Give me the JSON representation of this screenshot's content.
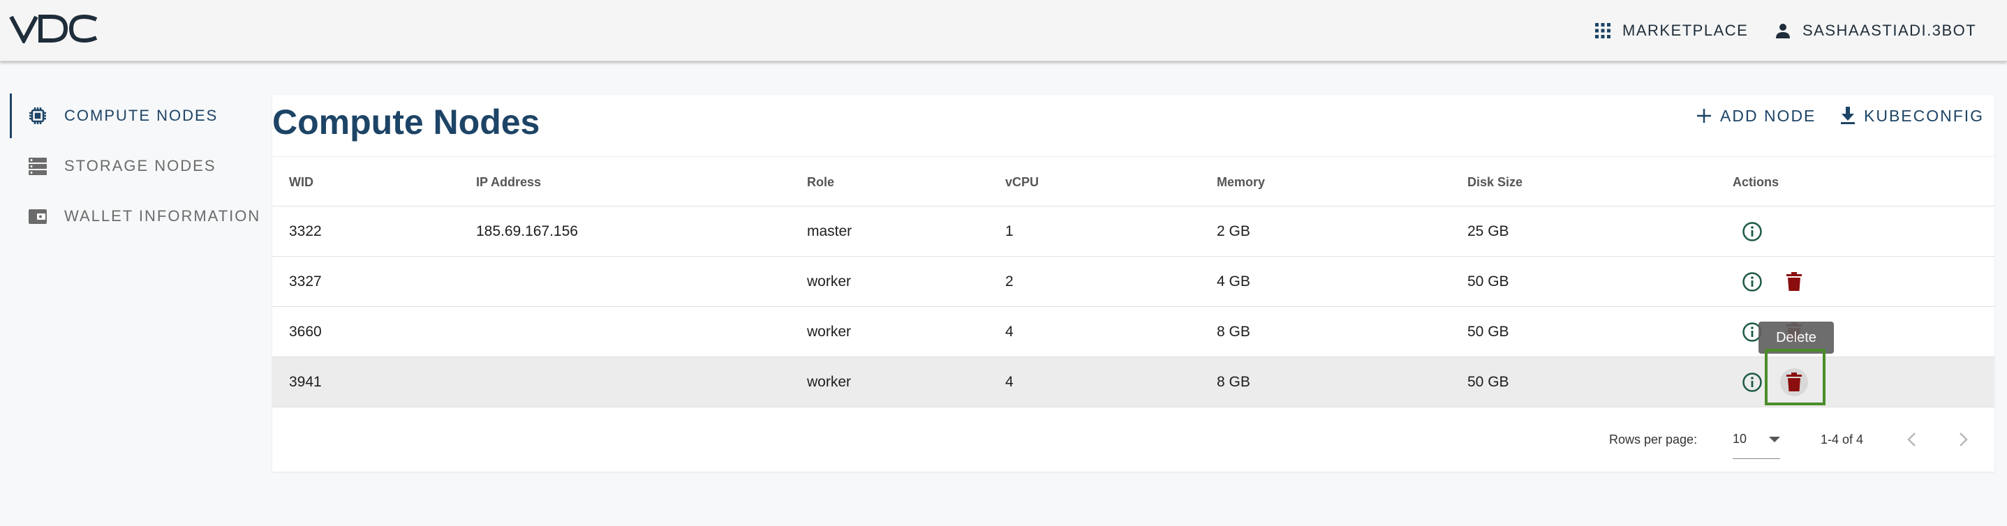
{
  "header": {
    "logo_text": "VDC",
    "marketplace_label": "MARKETPLACE",
    "user_label": "SASHAASTIADI.3BOT"
  },
  "sidebar": {
    "items": [
      {
        "label": "COMPUTE NODES",
        "icon": "chip-icon",
        "active": true
      },
      {
        "label": "STORAGE NODES",
        "icon": "storage-icon",
        "active": false
      },
      {
        "label": "WALLET INFORMATION",
        "icon": "wallet-icon",
        "active": false
      }
    ]
  },
  "main": {
    "title": "Compute Nodes",
    "add_node_label": "ADD NODE",
    "kubeconfig_label": "KUBECONFIG",
    "columns": [
      "WID",
      "IP Address",
      "Role",
      "vCPU",
      "Memory",
      "Disk Size",
      "Actions"
    ],
    "rows": [
      {
        "wid": "3322",
        "ip": "185.69.167.156",
        "role": "master",
        "vcpu": "1",
        "memory": "2 GB",
        "disk": "25 GB"
      },
      {
        "wid": "3327",
        "ip": "",
        "role": "worker",
        "vcpu": "2",
        "memory": "4 GB",
        "disk": "50 GB"
      },
      {
        "wid": "3660",
        "ip": "",
        "role": "worker",
        "vcpu": "4",
        "memory": "8 GB",
        "disk": "50 GB"
      },
      {
        "wid": "3941",
        "ip": "",
        "role": "worker",
        "vcpu": "4",
        "memory": "8 GB",
        "disk": "50 GB"
      }
    ],
    "tooltip": "Delete",
    "pagination": {
      "rows_per_page_label": "Rows per page:",
      "rows_per_page_value": "10",
      "range": "1-4 of 4"
    }
  },
  "colors": {
    "primary": "#1d4466",
    "info_icon": "#1e5a46",
    "delete_icon": "#8b0d0d",
    "highlight": "#4a8d2a"
  }
}
